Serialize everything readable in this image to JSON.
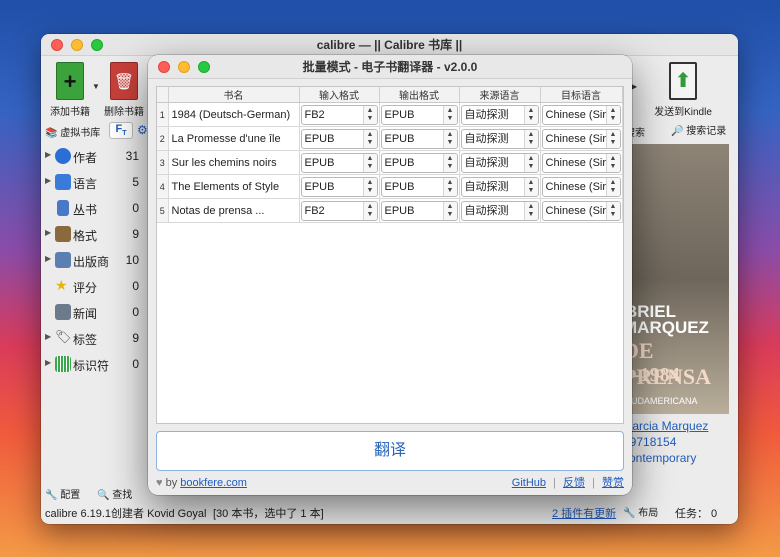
{
  "main_window": {
    "title": "calibre — || Calibre 书库 ||",
    "toolbar": {
      "add_books": "添加书籍",
      "remove_books": "删除书籍",
      "send_to_kindle": "发送到Kindle"
    },
    "secondary": {
      "virtual_library": "虚拟书库",
      "search": "搜索",
      "search_history": "搜索记录"
    },
    "sidebar": [
      {
        "label": "作者",
        "count": "31",
        "color": "#2b6fd6"
      },
      {
        "label": "语言",
        "count": "5",
        "color": "#3a7ad8"
      },
      {
        "label": "丛书",
        "count": "0",
        "color": "#4a78c8"
      },
      {
        "label": "格式",
        "count": "9",
        "color": "#8a6a3a"
      },
      {
        "label": "出版商",
        "count": "10",
        "color": "#5a7fb0"
      },
      {
        "label": "评分",
        "count": "0",
        "color": "#e8b600"
      },
      {
        "label": "新闻",
        "count": "0",
        "color": "#6b7b8c"
      },
      {
        "label": "标签",
        "count": "9",
        "color": "#777777"
      },
      {
        "label": "标识符",
        "count": "0",
        "color": "#3aa84a"
      }
    ],
    "cover_text": [
      "BRIEL",
      "MARQUEZ",
      "DE PRENSA",
      "0-1984",
      "SUDAMERICANA"
    ],
    "details": [
      "Garcia Marquez",
      "39718154",
      "contemporary"
    ],
    "bottom": {
      "preferences": "配置",
      "find": "查找",
      "layout": "布局"
    },
    "status": {
      "left": "calibre 6.19.1创建者 Kovid Goyal",
      "books": "[30 本书，选中了 1 本]",
      "plugins_update": "2 插件有更新",
      "jobs": "任务：  0"
    }
  },
  "dialog": {
    "title": "批量模式 - 电子书翻译器 - v2.0.0",
    "columns": [
      "书名",
      "输入格式",
      "输出格式",
      "来源语言",
      "目标语言"
    ],
    "rows": [
      {
        "num": "1",
        "title": "1984 (Deutsch-German)",
        "input": "FB2",
        "output": "EPUB",
        "source": "自动探测",
        "target": "Chinese (Sir"
      },
      {
        "num": "2",
        "title": "La Promesse d'une île",
        "input": "EPUB",
        "output": "EPUB",
        "source": "自动探测",
        "target": "Chinese (Sir"
      },
      {
        "num": "3",
        "title": "Sur les chemins noirs",
        "input": "EPUB",
        "output": "EPUB",
        "source": "自动探测",
        "target": "Chinese (Sir"
      },
      {
        "num": "4",
        "title": "The Elements of Style",
        "input": "EPUB",
        "output": "EPUB",
        "source": "自动探测",
        "target": "Chinese (Sir"
      },
      {
        "num": "5",
        "title": "Notas de prensa ...",
        "input": "FB2",
        "output": "EPUB",
        "source": "自动探测",
        "target": "Chinese (Sir"
      }
    ],
    "translate_button": "翻译",
    "footer": {
      "by": "by",
      "site": "bookfere.com",
      "github": "GitHub",
      "feedback": "反馈",
      "donate": "赞赏"
    }
  }
}
